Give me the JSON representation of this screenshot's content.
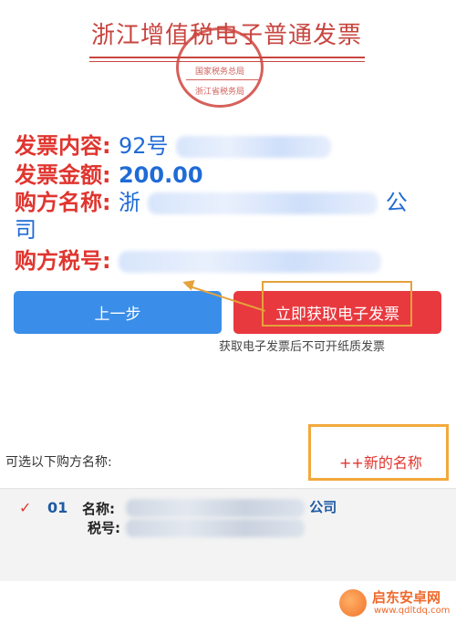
{
  "header": {
    "title": "浙江增值税电子普通发票",
    "seal_text_1": "国家税务总局",
    "seal_text_2": "浙江省税务局"
  },
  "invoice": {
    "content_label": "发票内容:",
    "content_value": "92号",
    "amount_label": "发票金额:",
    "amount_value": "200.00",
    "buyer_name_label": "购方名称:",
    "buyer_name_prefix": "浙",
    "buyer_name_suffix": "公",
    "buyer_name_cont": "司",
    "buyer_tax_label": "购方税号:"
  },
  "actions": {
    "prev_label": "上一步",
    "get_invoice_label": "立即获取电子发票",
    "notice": "获取电子发票后不可开纸质发票"
  },
  "buyers": {
    "section_label": "可选以下购方名称:",
    "new_name_label": "++新的名称",
    "items": [
      {
        "check": "✓",
        "index": "01",
        "name_label": "名称:",
        "name_suffix": "公司",
        "tax_label": "税号:"
      }
    ]
  },
  "watermark": {
    "text": "启东安卓网",
    "url": "www.qdltdq.com"
  },
  "colors": {
    "label_red": "#e0352f",
    "value_blue": "#1f6bd6",
    "prev_button": "#3a8ee9",
    "get_button": "#e8393f",
    "highlight": "#e5a23b"
  }
}
